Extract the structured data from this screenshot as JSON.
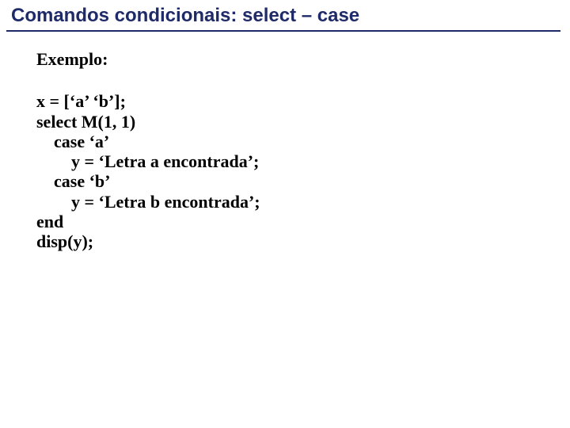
{
  "title": "Comandos condicionais: select – case",
  "example_label": "Exemplo:",
  "code": "x = [‘a’ ‘b’];\nselect M(1, 1)\n    case ‘a’\n        y = ‘Letra a encontrada’;\n    case ‘b’\n        y = ‘Letra b encontrada’;\nend\ndisp(y);"
}
